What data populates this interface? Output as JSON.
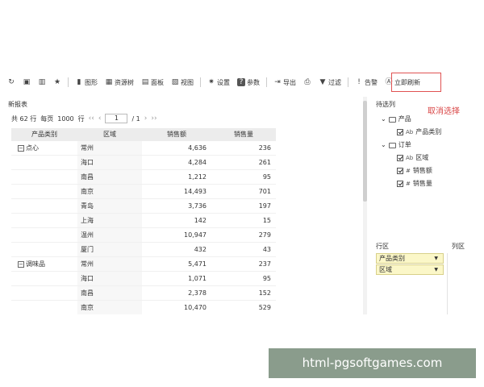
{
  "toolbar": {
    "items": [
      {
        "label": "",
        "icon": "refresh-icon"
      },
      {
        "label": "",
        "icon": "save-icon"
      },
      {
        "label": "",
        "icon": "bookmark-icon"
      },
      {
        "label": "",
        "icon": "star-icon"
      },
      {
        "label": "图形",
        "icon": "bar-chart-icon"
      },
      {
        "label": "资源树",
        "icon": "tree-icon"
      },
      {
        "label": "面板",
        "icon": "panel-icon"
      },
      {
        "label": "视图",
        "icon": "view-icon"
      },
      {
        "label": "设置",
        "icon": "gear-icon"
      },
      {
        "label": "参数",
        "icon": "help-icon"
      },
      {
        "label": "导出",
        "icon": "export-icon"
      },
      {
        "label": "",
        "icon": "print-icon"
      },
      {
        "label": "过滤",
        "icon": "filter-icon"
      },
      {
        "label": "告警",
        "icon": "alert-icon"
      },
      {
        "label": "立即刷新",
        "icon": "refresh-now-icon"
      }
    ]
  },
  "report": {
    "title": "新报表",
    "pager": {
      "total": "共 62 行",
      "per_page_label": "每页",
      "per_page_value": "1000",
      "row_unit": "行",
      "current_page": "1",
      "total_pages": "/ 1"
    },
    "columns": [
      "产品类别",
      "区域",
      "销售额",
      "销售量"
    ],
    "rows": [
      {
        "category": "点心",
        "region": "常州",
        "sales": "4,636",
        "qty": "236"
      },
      {
        "category": "",
        "region": "海口",
        "sales": "4,284",
        "qty": "261"
      },
      {
        "category": "",
        "region": "南昌",
        "sales": "1,212",
        "qty": "95"
      },
      {
        "category": "",
        "region": "南京",
        "sales": "14,493",
        "qty": "701"
      },
      {
        "category": "",
        "region": "青岛",
        "sales": "3,736",
        "qty": "197"
      },
      {
        "category": "",
        "region": "上海",
        "sales": "142",
        "qty": "15"
      },
      {
        "category": "",
        "region": "温州",
        "sales": "10,947",
        "qty": "279"
      },
      {
        "category": "",
        "region": "厦门",
        "sales": "432",
        "qty": "43"
      },
      {
        "category": "调味品",
        "region": "常州",
        "sales": "5,471",
        "qty": "237"
      },
      {
        "category": "",
        "region": "海口",
        "sales": "1,071",
        "qty": "95"
      },
      {
        "category": "",
        "region": "南昌",
        "sales": "2,378",
        "qty": "152"
      },
      {
        "category": "",
        "region": "南京",
        "sales": "10,470",
        "qty": "529"
      }
    ]
  },
  "filter_panel": {
    "title": "待选列",
    "cancel_label": "取消选择",
    "tree": [
      {
        "label": "产品",
        "type": "folder",
        "level": 0
      },
      {
        "label": "产品类别",
        "type": "Ab",
        "level": 1
      },
      {
        "label": "订单",
        "type": "folder",
        "level": 0
      },
      {
        "label": "区域",
        "type": "Ab",
        "level": 1
      },
      {
        "label": "销售额",
        "type": "#",
        "level": 1
      },
      {
        "label": "销售量",
        "type": "#",
        "level": 1
      }
    ],
    "row_zone_label": "行区",
    "col_zone_label": "列区",
    "row_fields": [
      "产品类别",
      "区域"
    ]
  },
  "watermark": "html-pgsoftgames.com"
}
